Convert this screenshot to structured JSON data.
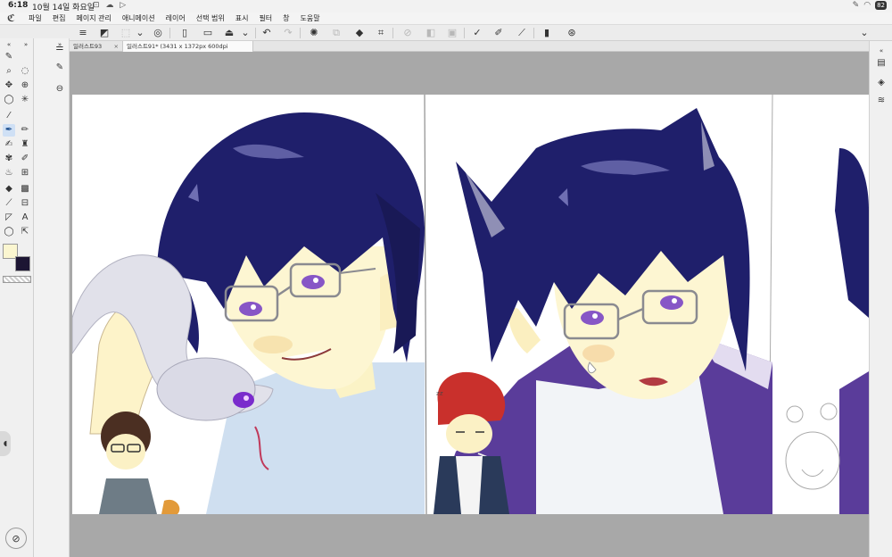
{
  "status": {
    "time": "6:18",
    "date": "10월 14일 화요일",
    "battery": "82"
  },
  "menu": {
    "items": [
      "파일",
      "편집",
      "페이지 관리",
      "애니메이션",
      "레이어",
      "선택 범위",
      "표시",
      "필터",
      "창",
      "도움말"
    ]
  },
  "tabs": [
    {
      "label": "일러스트93",
      "active": false
    },
    {
      "label": "일러스트91* (3431 x 1372px 600dpi 101.4%)",
      "active": true
    }
  ],
  "colors": {
    "main": "#fbf6d0",
    "sub": "#1c1533",
    "canvas_bg": "#a8a8a8",
    "hair": "#1f1f6b"
  }
}
